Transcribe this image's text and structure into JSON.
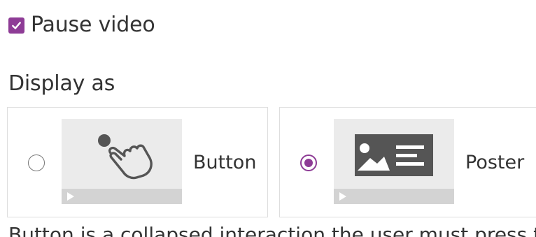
{
  "pause_video": {
    "label": "Pause video",
    "checked": true
  },
  "display_as": {
    "heading": "Display as",
    "options": [
      {
        "label": "Button",
        "selected": false,
        "thumbnail_icon": "tap-hand-icon"
      },
      {
        "label": "Poster",
        "selected": true,
        "thumbnail_icon": "image-text-poster-icon"
      }
    ]
  },
  "description": "Button is a collapsed interaction the user must press to open",
  "colors": {
    "accent": "#8e3c96",
    "text": "#333333",
    "thumb_bg": "#ebebeb",
    "thumb_bar": "#d3d3d3",
    "poster_dark": "#555555"
  }
}
